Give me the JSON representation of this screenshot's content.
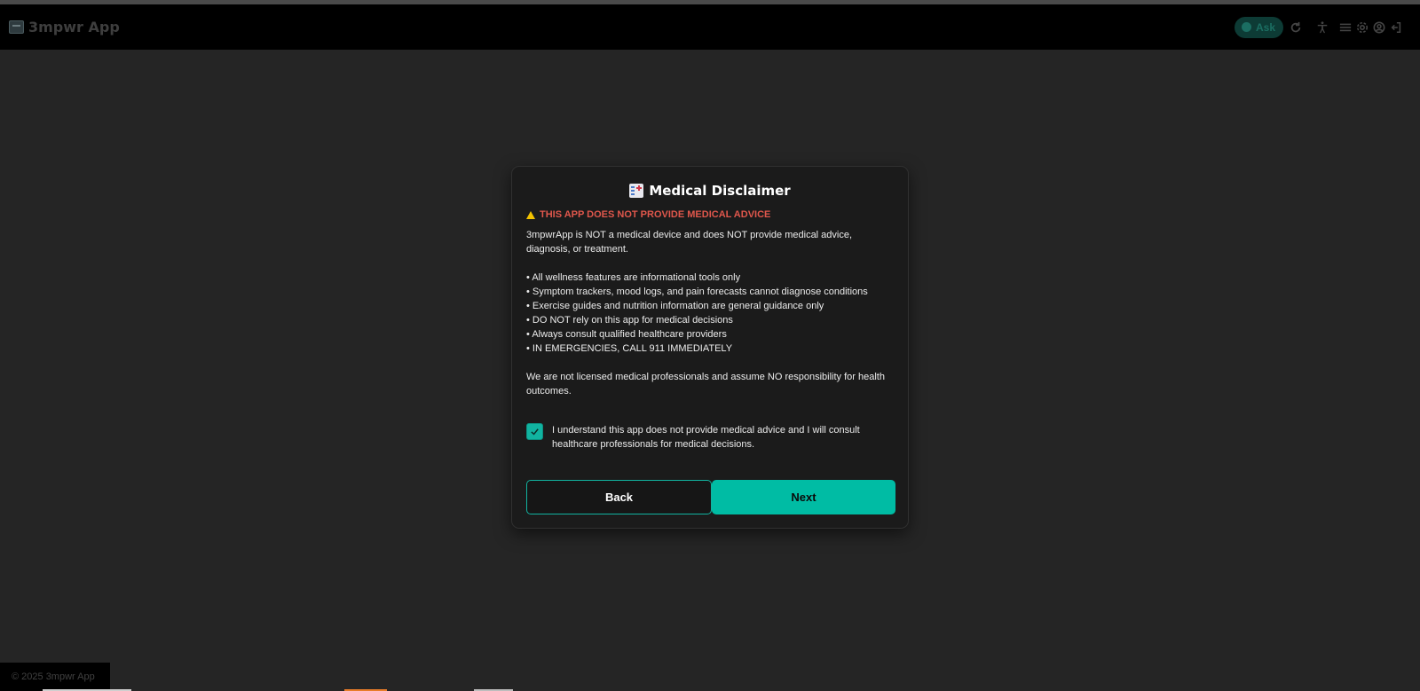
{
  "header": {
    "app_title": "3mpwr App",
    "ask_label": "Ask",
    "icons": [
      "refresh-icon",
      "accessibility-icon",
      "menu-icon",
      "settings-icon",
      "account-icon",
      "logout-icon"
    ]
  },
  "modal": {
    "title": "Medical Disclaimer",
    "warning": "THIS APP DOES NOT PROVIDE MEDICAL ADVICE",
    "intro": "3mpwrApp is NOT a medical device and does NOT provide medical advice, diagnosis, or treatment.",
    "bullets": [
      "All wellness features are informational tools only",
      "Symptom trackers, mood logs, and pain forecasts cannot diagnose conditions",
      "Exercise guides and nutrition information are general guidance only",
      "DO NOT rely on this app for medical decisions",
      "Always consult qualified healthcare providers",
      "IN EMERGENCIES, CALL 911 IMMEDIATELY"
    ],
    "closing": "We are not licensed medical professionals and assume NO responsibility for health outcomes.",
    "consent": {
      "checked": true,
      "label": "I understand this app does not provide medical advice and I will consult healthcare professionals for medical decisions."
    },
    "buttons": {
      "back": "Back",
      "next": "Next"
    }
  },
  "footer": {
    "copyright": "© 2025 3mpwr App"
  },
  "colors": {
    "accent": "#00bca4",
    "warning": "#e0574c",
    "background": "#252525",
    "modal_bg": "#1b1b1b"
  }
}
